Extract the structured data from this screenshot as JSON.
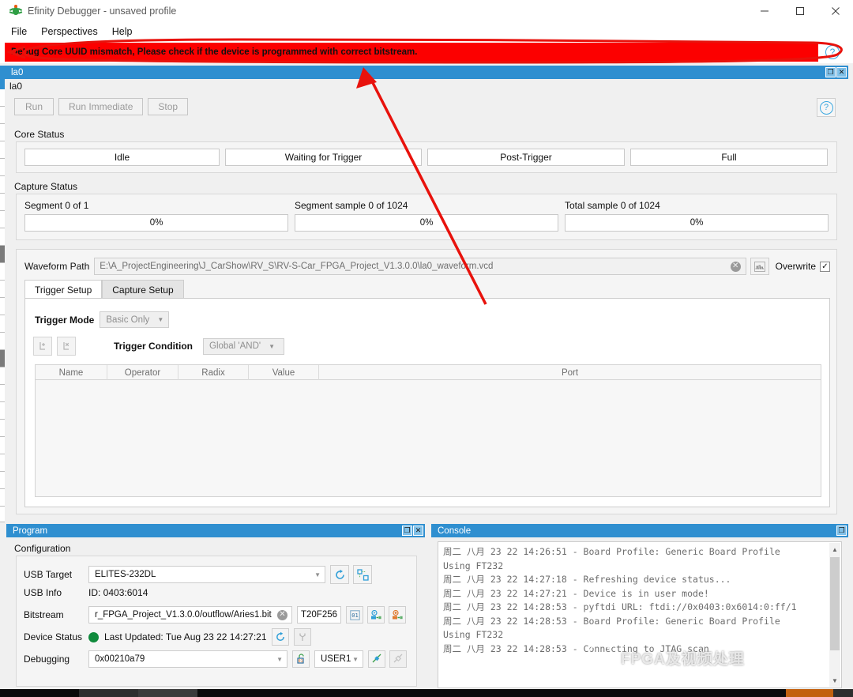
{
  "window": {
    "title": "Efinity Debugger - unsaved profile",
    "icon": "bug-icon",
    "minimize": "–",
    "maximize": "□",
    "close": "✕"
  },
  "menu": {
    "items": [
      {
        "label": "File"
      },
      {
        "label": "Perspectives"
      },
      {
        "label": "Help"
      }
    ]
  },
  "error": {
    "message": "Debug Core UUID mismatch, Please check if the device is programmed with correct bitstream.",
    "background": "#fc0000",
    "help_icon": "?"
  },
  "panel": {
    "title": "la0",
    "tab_label": "la0",
    "restore_icon": "❐",
    "close_icon": "✕"
  },
  "toolbar": {
    "run": "Run",
    "run_immediate": "Run Immediate",
    "stop": "Stop",
    "help_icon": "?"
  },
  "core_status": {
    "label": "Core Status",
    "states": [
      {
        "label": "Idle"
      },
      {
        "label": "Waiting for Trigger"
      },
      {
        "label": "Post-Trigger"
      },
      {
        "label": "Full"
      }
    ]
  },
  "capture_status": {
    "label": "Capture Status",
    "columns": [
      {
        "label": "Segment 0 of 1",
        "percent": "0%"
      },
      {
        "label": "Segment sample 0 of 1024",
        "percent": "0%"
      },
      {
        "label": "Total sample 0 of 1024",
        "percent": "0%"
      }
    ]
  },
  "waveform": {
    "path_label": "Waveform Path",
    "path_value": "E:\\A_ProjectEngineering\\J_CarShow\\RV_S\\RV-S-Car_FPGA_Project_V1.3.0.0\\la0_waveform.vcd",
    "clear_icon": "✕",
    "browse_icon": "waveform-icon",
    "overwrite_label": "Overwrite",
    "overwrite_checked": "✓"
  },
  "tabs": [
    {
      "label": "Trigger Setup",
      "active": true
    },
    {
      "label": "Capture Setup",
      "active": false
    }
  ],
  "trigger": {
    "mode_label": "Trigger Mode",
    "mode_value": "Basic Only",
    "condition_label": "Trigger Condition",
    "condition_value": "Global 'AND'",
    "add_icon": "add-trigger-icon",
    "remove_icon": "remove-trigger-icon",
    "caret": "▼",
    "table": {
      "headers": [
        "Name",
        "Operator",
        "Radix",
        "Value",
        "Port"
      ],
      "rows": []
    }
  },
  "program": {
    "title": "Program",
    "restore_icon": "❐",
    "close_icon": "✕",
    "configuration_label": "Configuration",
    "usb_target_label": "USB Target",
    "usb_target_value": "ELITES-232DL",
    "usb_info_label": "USB Info",
    "usb_info_value": "ID: 0403:6014",
    "bitstream_label": "Bitstream",
    "bitstream_value": "r_FPGA_Project_V1.3.0.0/outflow/Aries1.bit",
    "bitstream_clear": "✕",
    "device_part": "T20F256",
    "device_status_label": "Device Status",
    "device_status_color": "#0f8a3c",
    "last_updated": "Last Updated: Tue Aug 23 22 14:27:21",
    "debugging_label": "Debugging",
    "debugging_value": "0x00210a79",
    "user_register": "USER1",
    "caret": "▼",
    "icons": {
      "refresh": "refresh-icon",
      "scan_chain": "scan-chain-icon",
      "binary": "binary-icon",
      "program_flash": "program-flash-icon",
      "program_device": "program-device-icon",
      "device_refresh": "refresh-icon",
      "tools": "tools-icon",
      "unlock": "unlock-icon",
      "debug_connect": "debug-connect-icon",
      "debug_disconnect": "debug-disconnect-icon"
    }
  },
  "console": {
    "title": "Console",
    "restore_icon": "❐",
    "lines": [
      "周二 八月 23 22 14:26:51 - Board Profile: Generic Board Profile",
      "Using FT232",
      "周二 八月 23 22 14:27:18 - Refreshing device status...",
      "周二 八月 23 22 14:27:21 - Device is in user mode!",
      "周二 八月 23 22 14:28:53 - pyftdi URL: ftdi://0x0403:0x6014:0:ff/1",
      "周二 八月 23 22 14:28:53 - Board Profile: Generic Board Profile",
      "Using FT232",
      "周二 八月 23 22 14:28:53 - Connecting to JTAG_scan"
    ],
    "scroll_up": "▲",
    "scroll_down": "▼"
  },
  "watermark": {
    "text": "FPGA及视频处理"
  },
  "colors": {
    "accent_blue": "#2f8fd0",
    "error_red": "#fc0000",
    "annotation_red": "#e8120c",
    "panel_gray": "#f0f0f0",
    "status_green": "#0f8a3c"
  }
}
